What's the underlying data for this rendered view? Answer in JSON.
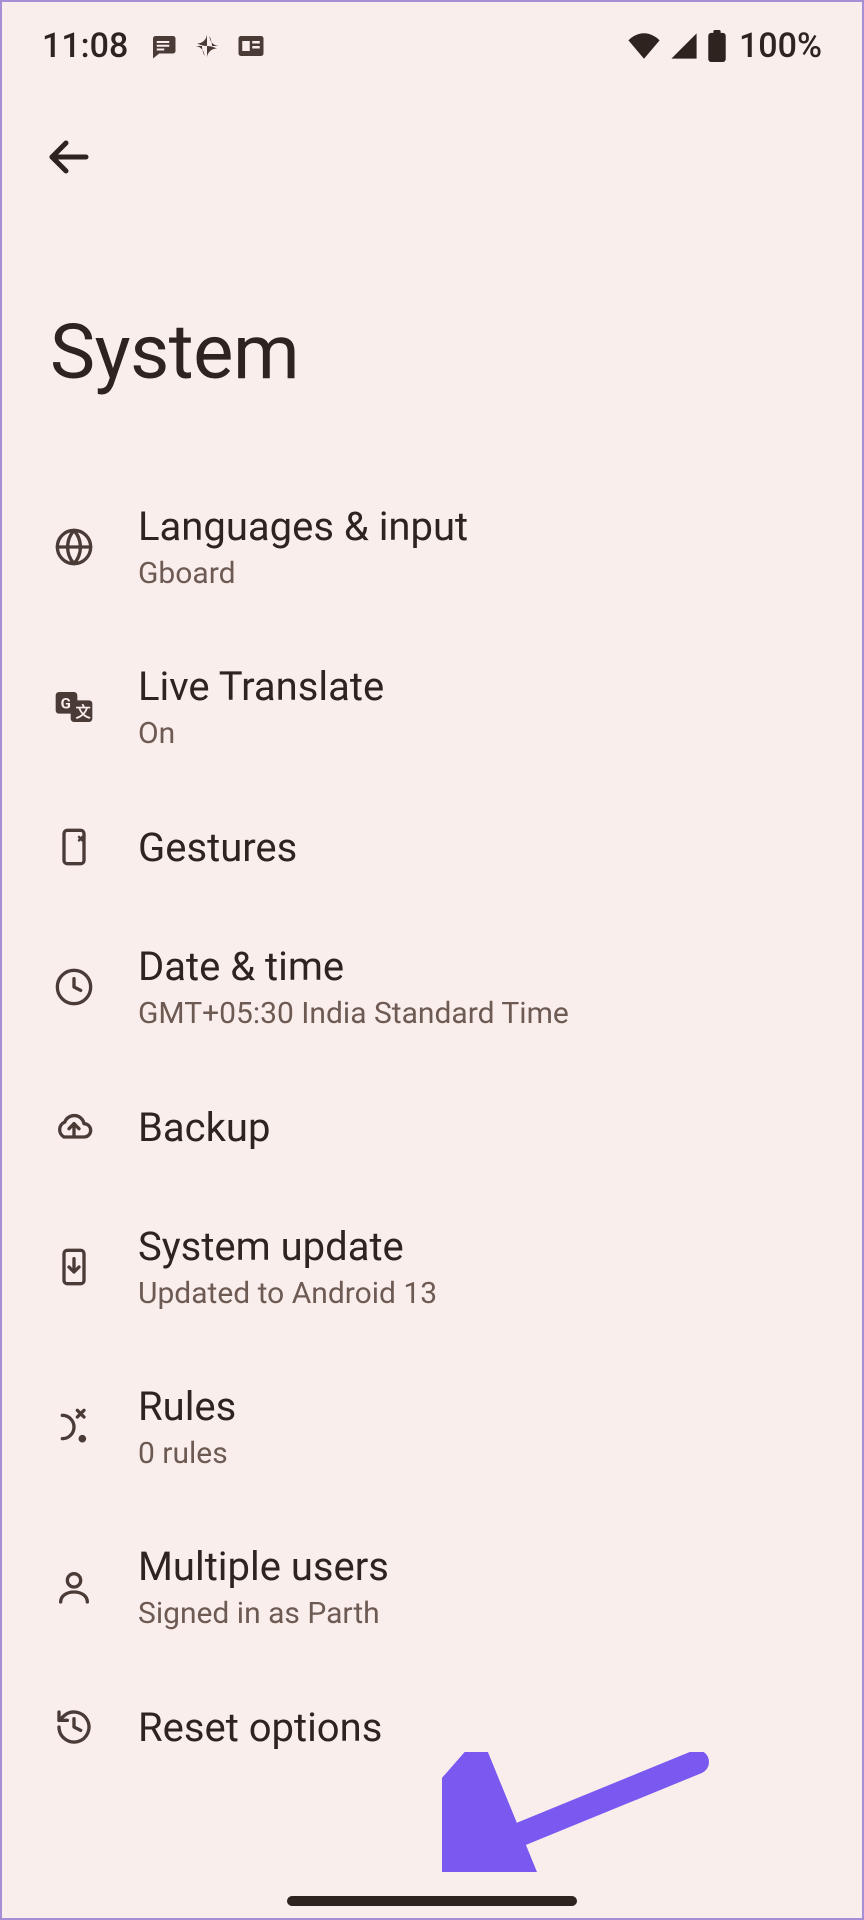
{
  "status_bar": {
    "time": "11:08",
    "battery_pct": "100%"
  },
  "page": {
    "title": "System"
  },
  "settings": [
    {
      "icon": "globe-icon",
      "title": "Languages & input",
      "subtitle": "Gboard"
    },
    {
      "icon": "translate-icon",
      "title": "Live Translate",
      "subtitle": "On"
    },
    {
      "icon": "gestures-icon",
      "title": "Gestures",
      "subtitle": ""
    },
    {
      "icon": "clock-icon",
      "title": "Date & time",
      "subtitle": "GMT+05:30 India Standard Time"
    },
    {
      "icon": "cloud-up-icon",
      "title": "Backup",
      "subtitle": ""
    },
    {
      "icon": "phone-down-icon",
      "title": "System update",
      "subtitle": "Updated to Android 13"
    },
    {
      "icon": "rules-icon",
      "title": "Rules",
      "subtitle": "0 rules"
    },
    {
      "icon": "person-icon",
      "title": "Multiple users",
      "subtitle": "Signed in as Parth"
    },
    {
      "icon": "history-icon",
      "title": "Reset options",
      "subtitle": ""
    }
  ],
  "annotation": {
    "color": "#7a59f0"
  }
}
